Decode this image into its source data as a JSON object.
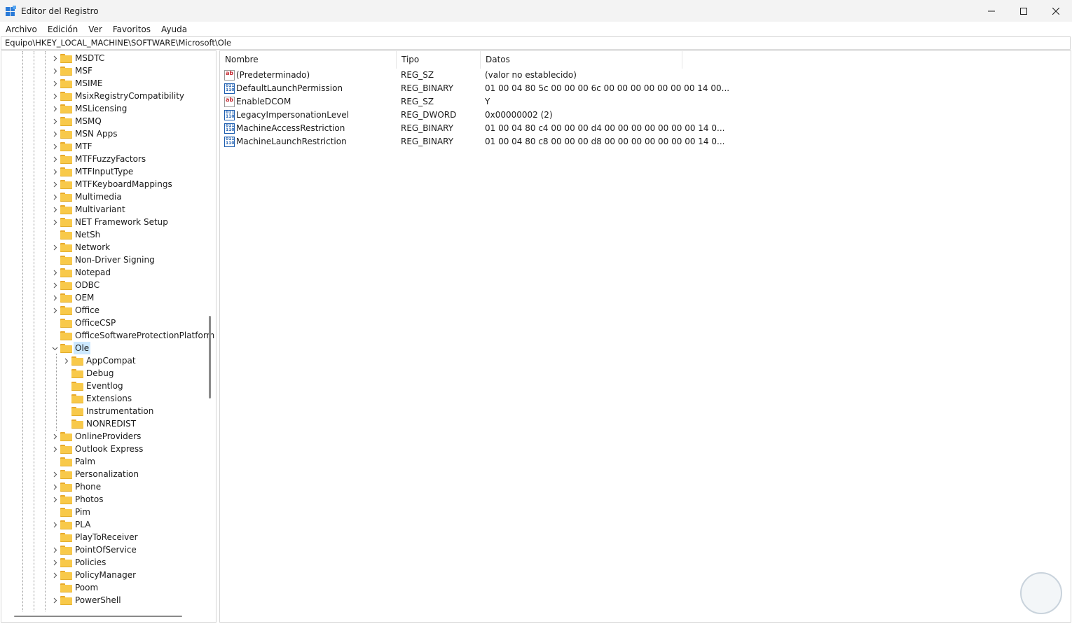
{
  "window": {
    "title": "Editor del Registro",
    "icon": "registry-editor-icon",
    "accent": "#2b7bd8"
  },
  "menu": [
    "Archivo",
    "Edición",
    "Ver",
    "Favoritos",
    "Ayuda"
  ],
  "address_bar": "Equipo\\HKEY_LOCAL_MACHINE\\SOFTWARE\\Microsoft\\Ole",
  "tree": {
    "items": [
      {
        "label": "MSDTC",
        "expandable": true,
        "level": 0
      },
      {
        "label": "MSF",
        "expandable": true,
        "level": 0
      },
      {
        "label": "MSIME",
        "expandable": true,
        "level": 0
      },
      {
        "label": "MsixRegistryCompatibility",
        "expandable": true,
        "level": 0
      },
      {
        "label": "MSLicensing",
        "expandable": true,
        "level": 0
      },
      {
        "label": "MSMQ",
        "expandable": true,
        "level": 0
      },
      {
        "label": "MSN Apps",
        "expandable": true,
        "level": 0
      },
      {
        "label": "MTF",
        "expandable": true,
        "level": 0
      },
      {
        "label": "MTFFuzzyFactors",
        "expandable": true,
        "level": 0
      },
      {
        "label": "MTFInputType",
        "expandable": true,
        "level": 0
      },
      {
        "label": "MTFKeyboardMappings",
        "expandable": true,
        "level": 0
      },
      {
        "label": "Multimedia",
        "expandable": true,
        "level": 0
      },
      {
        "label": "Multivariant",
        "expandable": true,
        "level": 0
      },
      {
        "label": "NET Framework Setup",
        "expandable": true,
        "level": 0
      },
      {
        "label": "NetSh",
        "expandable": false,
        "level": 0
      },
      {
        "label": "Network",
        "expandable": true,
        "level": 0
      },
      {
        "label": "Non-Driver Signing",
        "expandable": false,
        "level": 0
      },
      {
        "label": "Notepad",
        "expandable": true,
        "level": 0
      },
      {
        "label": "ODBC",
        "expandable": true,
        "level": 0
      },
      {
        "label": "OEM",
        "expandable": true,
        "level": 0
      },
      {
        "label": "Office",
        "expandable": true,
        "level": 0
      },
      {
        "label": "OfficeCSP",
        "expandable": false,
        "level": 0
      },
      {
        "label": "OfficeSoftwareProtectionPlatform",
        "expandable": false,
        "level": 0
      },
      {
        "label": "Ole",
        "expandable": true,
        "expanded": true,
        "selected": true,
        "level": 0
      },
      {
        "label": "AppCompat",
        "expandable": true,
        "level": 1
      },
      {
        "label": "Debug",
        "expandable": false,
        "level": 1
      },
      {
        "label": "Eventlog",
        "expandable": false,
        "level": 1
      },
      {
        "label": "Extensions",
        "expandable": false,
        "level": 1
      },
      {
        "label": "Instrumentation",
        "expandable": false,
        "level": 1
      },
      {
        "label": "NONREDIST",
        "expandable": false,
        "level": 1
      },
      {
        "label": "OnlineProviders",
        "expandable": true,
        "level": 0
      },
      {
        "label": "Outlook Express",
        "expandable": true,
        "level": 0
      },
      {
        "label": "Palm",
        "expandable": false,
        "level": 0
      },
      {
        "label": "Personalization",
        "expandable": true,
        "level": 0
      },
      {
        "label": "Phone",
        "expandable": true,
        "level": 0
      },
      {
        "label": "Photos",
        "expandable": true,
        "level": 0
      },
      {
        "label": "Pim",
        "expandable": false,
        "level": 0
      },
      {
        "label": "PLA",
        "expandable": true,
        "level": 0
      },
      {
        "label": "PlayToReceiver",
        "expandable": false,
        "level": 0
      },
      {
        "label": "PointOfService",
        "expandable": true,
        "level": 0
      },
      {
        "label": "Policies",
        "expandable": true,
        "level": 0
      },
      {
        "label": "PolicyManager",
        "expandable": true,
        "level": 0
      },
      {
        "label": "Poom",
        "expandable": false,
        "level": 0
      },
      {
        "label": "PowerShell",
        "expandable": true,
        "level": 0
      }
    ]
  },
  "values_table": {
    "columns": [
      "Nombre",
      "Tipo",
      "Datos"
    ],
    "rows": [
      {
        "name": "(Predeterminado)",
        "type": "REG_SZ",
        "data": "(valor no establecido)",
        "icon": "string-value-icon"
      },
      {
        "name": "DefaultLaunchPermission",
        "type": "REG_BINARY",
        "data": "01 00 04 80 5c 00 00 00 6c 00 00 00 00 00 00 00 14 00...",
        "icon": "binary-value-icon"
      },
      {
        "name": "EnableDCOM",
        "type": "REG_SZ",
        "data": "Y",
        "icon": "string-value-icon"
      },
      {
        "name": "LegacyImpersonationLevel",
        "type": "REG_DWORD",
        "data": "0x00000002 (2)",
        "icon": "binary-value-icon"
      },
      {
        "name": "MachineAccessRestriction",
        "type": "REG_BINARY",
        "data": "01 00 04 80 c4 00 00 00 d4 00 00 00 00 00 00 00 14 0...",
        "icon": "binary-value-icon"
      },
      {
        "name": "MachineLaunchRestriction",
        "type": "REG_BINARY",
        "data": "01 00 04 80 c8 00 00 00 d8 00 00 00 00 00 00 00 14 0...",
        "icon": "binary-value-icon"
      }
    ]
  },
  "icon_glyphs": {
    "string": "ab",
    "binary": "011\n110"
  },
  "colors": {
    "selection": "#cce8ff",
    "folder": "#f8c94a"
  }
}
